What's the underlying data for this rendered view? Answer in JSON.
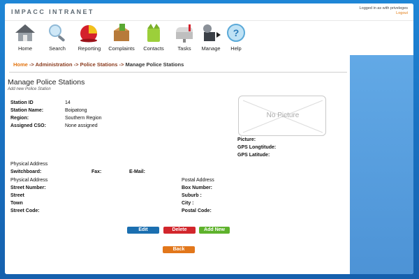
{
  "app": {
    "brand": "IMPACC INTRANET",
    "logged_in_text": "Logged in as with priveleges",
    "logout_label": "Logout"
  },
  "nav": {
    "items": [
      {
        "label": "Home",
        "icon": "house-icon"
      },
      {
        "label": "Search",
        "icon": "magnifier-icon"
      },
      {
        "label": "Reporting",
        "icon": "pie-chart-icon"
      },
      {
        "label": "Complaints",
        "icon": "complaints-icon"
      },
      {
        "label": "Contacts",
        "icon": "contacts-icon"
      },
      {
        "label": "Tasks",
        "icon": "mailbox-icon"
      },
      {
        "label": "Manage",
        "icon": "manage-icon"
      },
      {
        "label": "Help",
        "icon": "help-icon"
      }
    ]
  },
  "breadcrumb": {
    "home": "Home",
    "sep": "->",
    "admin": "Administration",
    "stations": "Police Stations",
    "current": "Manage Police Stations"
  },
  "page": {
    "title": "Manage Police Stations",
    "subtitle": "Add new Police Station"
  },
  "station": {
    "id_label": "Station ID",
    "id_value": "14",
    "name_label": "Station Name:",
    "name_value": "Boipatong",
    "region_label": "Region:",
    "region_value": "Southern Region",
    "cso_label": "Assigned CSO:",
    "cso_value": "None assigned"
  },
  "picture": {
    "placeholder": "No Picture",
    "picture_label": "Picture:",
    "gps_long_label": "GPS Longtitude:",
    "gps_lat_label": "GPS Latitude:"
  },
  "contact": {
    "physical_address_heading": "Physical Address",
    "switchboard_label": "Switchboard:",
    "fax_label": "Fax:",
    "email_label": "E-Mail:"
  },
  "address": {
    "physical_heading": "Physical Address",
    "street_number_label": "Street Number:",
    "street_label": "Street",
    "town_label": "Town",
    "street_code_label": "Street Code:",
    "postal_heading": "Postal Address",
    "box_number_label": "Box Number:",
    "suburb_label": "Suburb :",
    "city_label": "City :",
    "postal_code_label": "Postal Code:"
  },
  "actions": {
    "edit": "Edit",
    "delete": "Delete",
    "add_new": "Add New",
    "back": "Back"
  },
  "colors": {
    "accent_orange": "#e2730e",
    "brand_blue": "#1f86d6",
    "edit_blue": "#1b6fb0",
    "delete_red": "#d2262c",
    "add_green": "#5eb22c"
  }
}
